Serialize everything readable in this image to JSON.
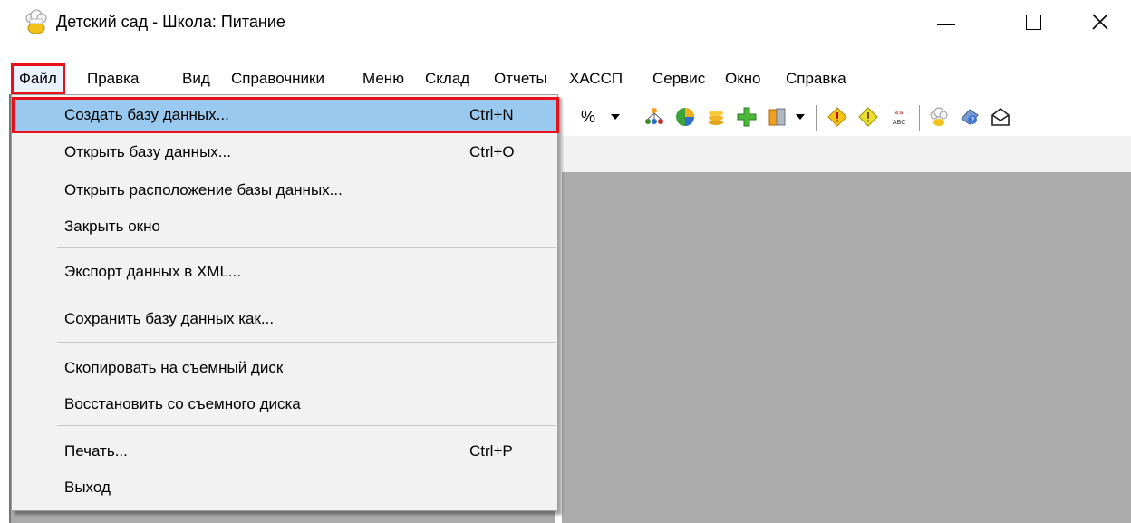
{
  "window": {
    "title": "Детский сад - Школа: Питание",
    "icon": "chef-hat-icon"
  },
  "menubar": {
    "items": [
      {
        "label": "Файл"
      },
      {
        "label": "Правка"
      },
      {
        "label": "Вид"
      },
      {
        "label": "Справочники"
      },
      {
        "label": "Меню"
      },
      {
        "label": "Склад"
      },
      {
        "label": "Отчеты"
      },
      {
        "label": "ХАССП"
      },
      {
        "label": "Сервис"
      },
      {
        "label": "Окно"
      },
      {
        "label": "Справка"
      }
    ]
  },
  "toolbar": {
    "percent_label": "%",
    "icons": [
      "percent-icon",
      "tree-icon",
      "pie-chart-icon",
      "coins-icon",
      "add-icon",
      "book-icon",
      "warning-icon",
      "warning-alt-icon",
      "abc-icon",
      "chef-hat-icon",
      "info-icon",
      "mail-icon"
    ]
  },
  "file_menu": {
    "items": [
      {
        "label": "Создать базу данных...",
        "shortcut": "Ctrl+N"
      },
      {
        "label": "Открыть базу данных...",
        "shortcut": "Ctrl+O"
      },
      {
        "label": "Открыть расположение базы данных..."
      },
      {
        "label": "Закрыть окно"
      },
      {
        "label": "Экспорт данных в XML..."
      },
      {
        "label": "Сохранить базу данных как..."
      },
      {
        "label": "Скопировать на съемный диск"
      },
      {
        "label": "Восстановить со съемного диска"
      },
      {
        "label": "Печать...",
        "shortcut": "Ctrl+P"
      },
      {
        "label": "Выход"
      }
    ]
  },
  "colors": {
    "highlight_border": "#e8101a",
    "menu_highlight": "#99c9ef",
    "client_background": "#ababab",
    "menu_background": "#f2f2f2"
  }
}
